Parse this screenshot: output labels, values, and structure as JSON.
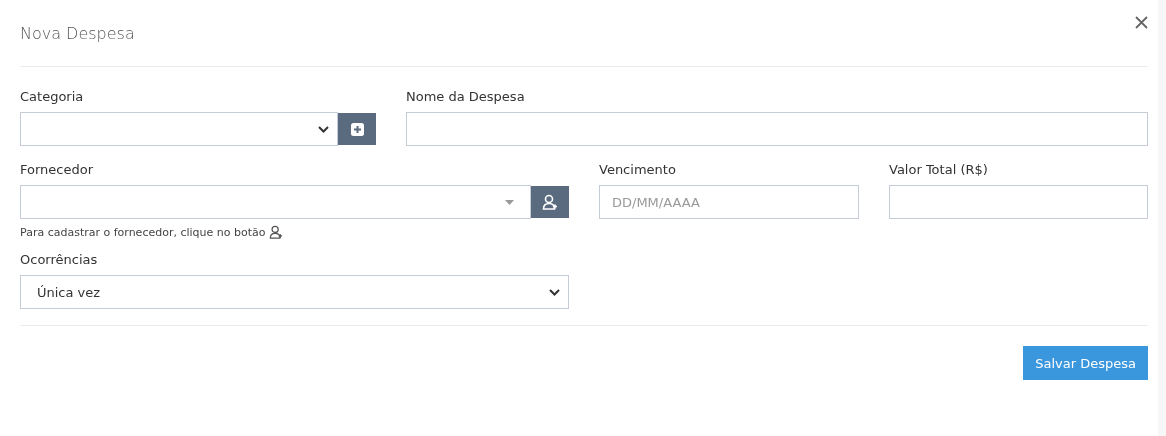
{
  "dialog": {
    "title": "Nova Despesa"
  },
  "category": {
    "label": "Categoria"
  },
  "expense_name": {
    "label": "Nome da Despesa"
  },
  "supplier": {
    "label": "Fornecedor",
    "help": "Para cadastrar o fornecedor, clique no botão"
  },
  "due_date": {
    "label": "Vencimento",
    "placeholder": "DD/MM/AAAA"
  },
  "total": {
    "label": "Valor Total (R$)"
  },
  "occurrences": {
    "label": "Ocorrências",
    "value": "Única vez"
  },
  "buttons": [
    {
      "label": "Salvar Despesa"
    }
  ]
}
